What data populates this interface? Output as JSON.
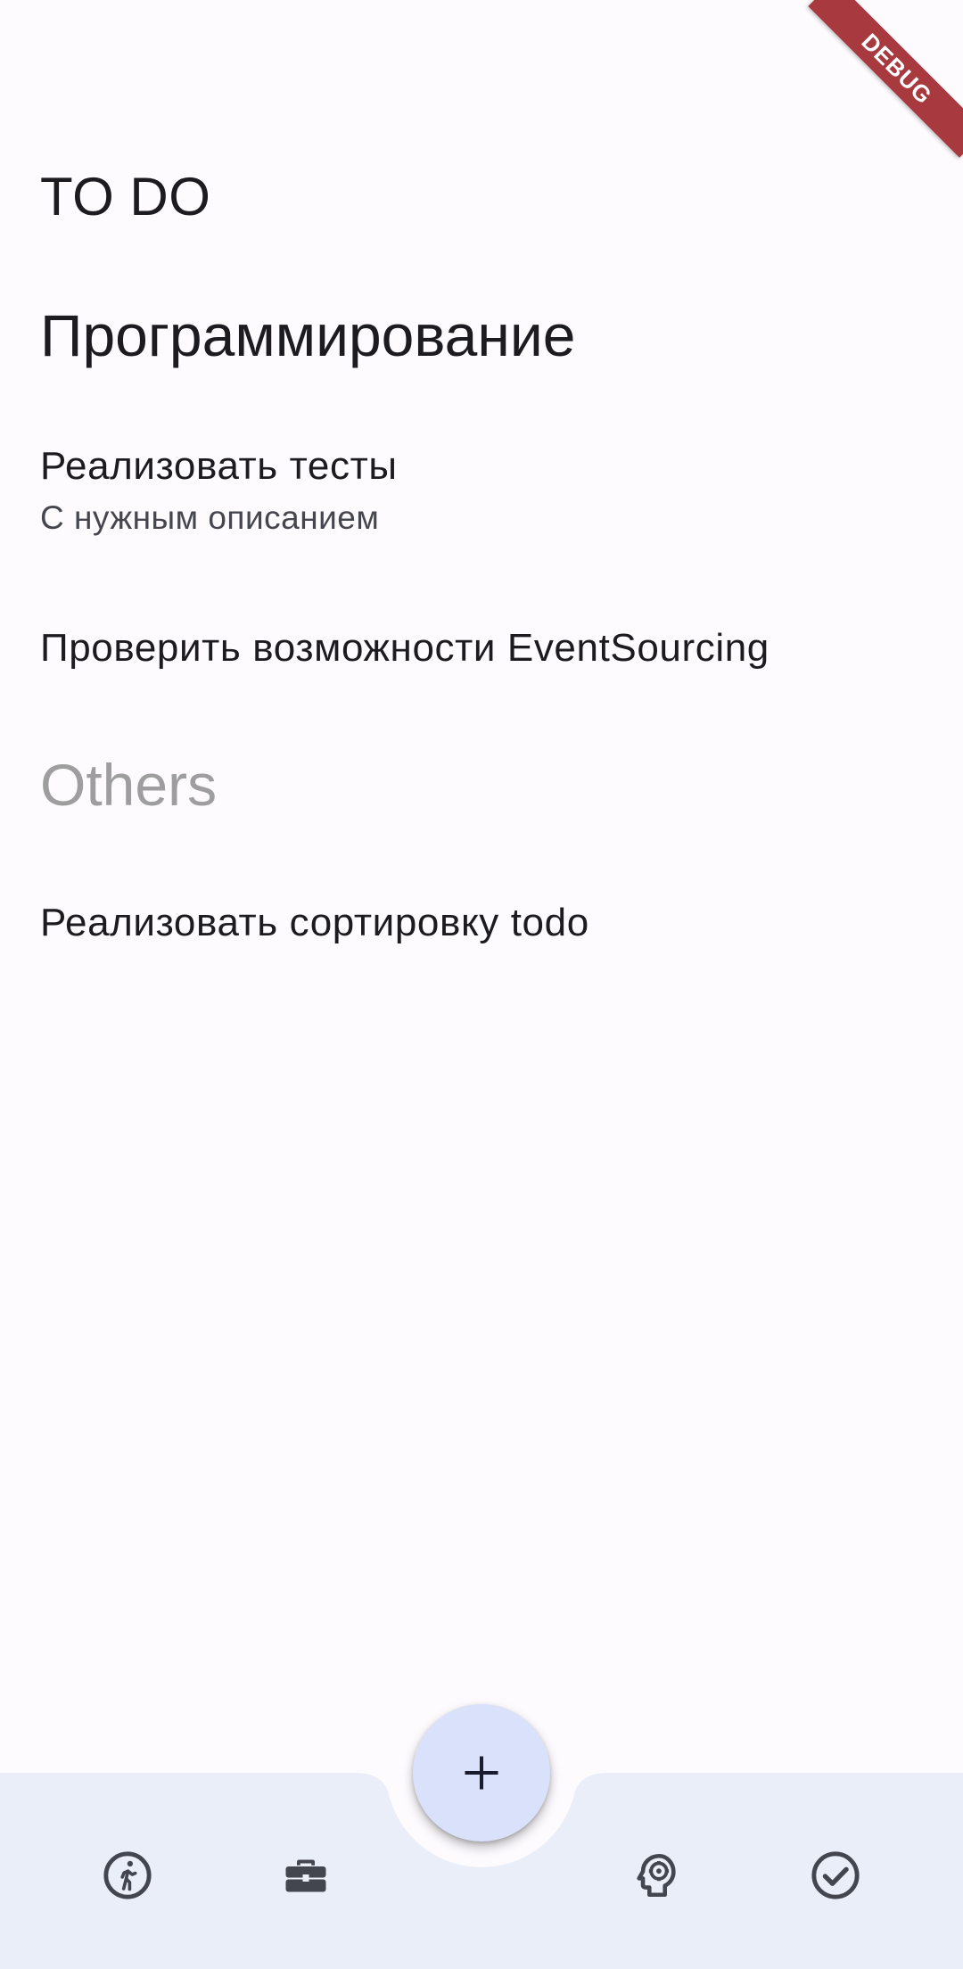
{
  "app": {
    "title": "TO DO"
  },
  "debug_banner": "DEBUG",
  "sections": [
    {
      "title": "Программирование",
      "tasks": [
        {
          "title": "Реализовать тесты",
          "description": "С нужным описанием"
        },
        {
          "title": "Проверить возможности EventSourcing",
          "description": ""
        }
      ]
    },
    {
      "title": "Others",
      "tasks": [
        {
          "title": "Реализовать сортировку todo",
          "description": ""
        }
      ]
    }
  ],
  "fab": {
    "icon": "plus-icon"
  },
  "bottom_nav": {
    "items": [
      {
        "icon": "running-person-icon"
      },
      {
        "icon": "briefcase-icon"
      },
      {
        "icon": "psychology-head-gear-icon"
      },
      {
        "icon": "check-circle-icon"
      }
    ]
  },
  "colors": {
    "background": "#fdfbfe",
    "bottom_bar": "#eaeef8",
    "fab": "#dae2fb",
    "icon": "#44464f",
    "muted_section": "#9e9e9e",
    "debug_ribbon": "#a83a3f"
  }
}
